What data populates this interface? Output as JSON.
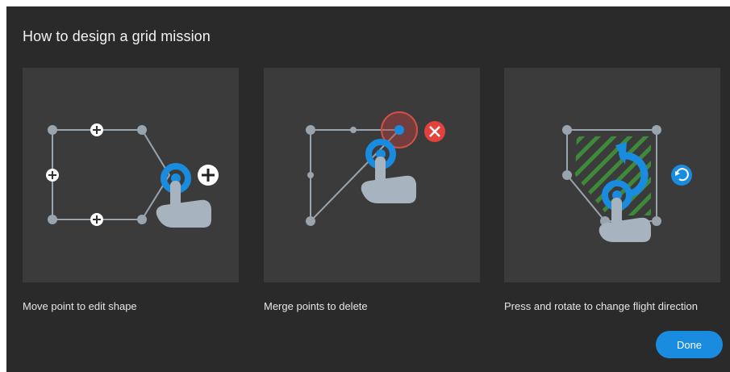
{
  "dialog": {
    "title": "How to design a grid mission",
    "done_label": "Done"
  },
  "cards": [
    {
      "caption": "Move point to edit shape",
      "illustration": "move-point-illustration"
    },
    {
      "caption": "Merge points to delete",
      "illustration": "merge-points-illustration"
    },
    {
      "caption": "Press and rotate to change flight direction",
      "illustration": "rotate-direction-illustration"
    }
  ],
  "colors": {
    "dialog_bg": "#2a2a2a",
    "card_bg": "#3b3b3b",
    "accent": "#1a8ce0",
    "danger": "#e2413d",
    "hatch": "#3f8a3a",
    "node": "#9aa4ad",
    "hand": "#a7b4bf"
  }
}
